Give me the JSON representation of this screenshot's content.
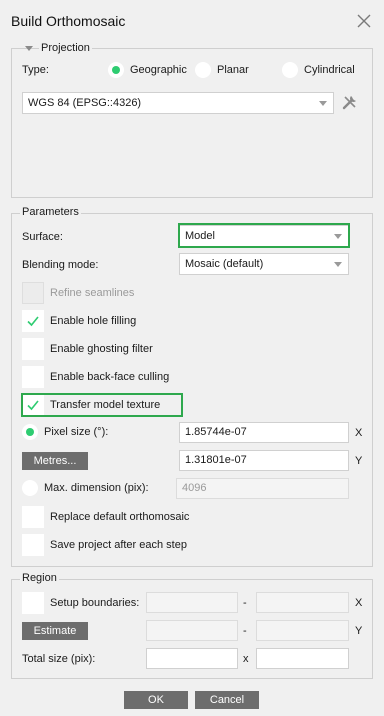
{
  "window": {
    "title": "Build Orthomosaic",
    "close_icon": "close-icon"
  },
  "projection": {
    "group_label": "Projection",
    "type_label": "Type:",
    "types": [
      "Geographic",
      "Planar",
      "Cylindrical"
    ],
    "selected_type": "Geographic",
    "crs_value": "WGS 84 (EPSG::4326)",
    "tool_icon": "tools-icon"
  },
  "parameters": {
    "group_label": "Parameters",
    "surface_label": "Surface:",
    "surface_value": "Model",
    "blending_label": "Blending mode:",
    "blending_value": "Mosaic (default)",
    "refine_seamlines": {
      "label": "Refine seamlines",
      "checked": false,
      "enabled": false
    },
    "hole_filling": {
      "label": "Enable hole filling",
      "checked": true
    },
    "ghosting_filter": {
      "label": "Enable ghosting filter",
      "checked": false
    },
    "backface_culling": {
      "label": "Enable back-face culling",
      "checked": false
    },
    "transfer_texture": {
      "label": "Transfer model texture",
      "checked": true
    },
    "pixel_size_label": "Pixel size (°):",
    "pixel_size_x": "1.85744e-07",
    "pixel_size_y": "1.31801e-07",
    "metres_button": "Metres...",
    "max_dimension_label": "Max. dimension (pix):",
    "max_dimension_value": "4096",
    "axis_x": "X",
    "axis_y": "Y",
    "replace_default": {
      "label": "Replace default orthomosaic",
      "checked": false
    },
    "save_project": {
      "label": "Save project after each step",
      "checked": false
    }
  },
  "region": {
    "group_label": "Region",
    "setup_boundaries_label": "Setup boundaries:",
    "estimate_button": "Estimate",
    "total_size_label": "Total size (pix):",
    "dash": "-",
    "times": "x",
    "axis_x": "X",
    "axis_y": "Y"
  },
  "footer": {
    "ok": "OK",
    "cancel": "Cancel"
  },
  "colors": {
    "accent": "#2ecc71",
    "highlight": "#2ea84d",
    "button": "#6d6d6d"
  }
}
